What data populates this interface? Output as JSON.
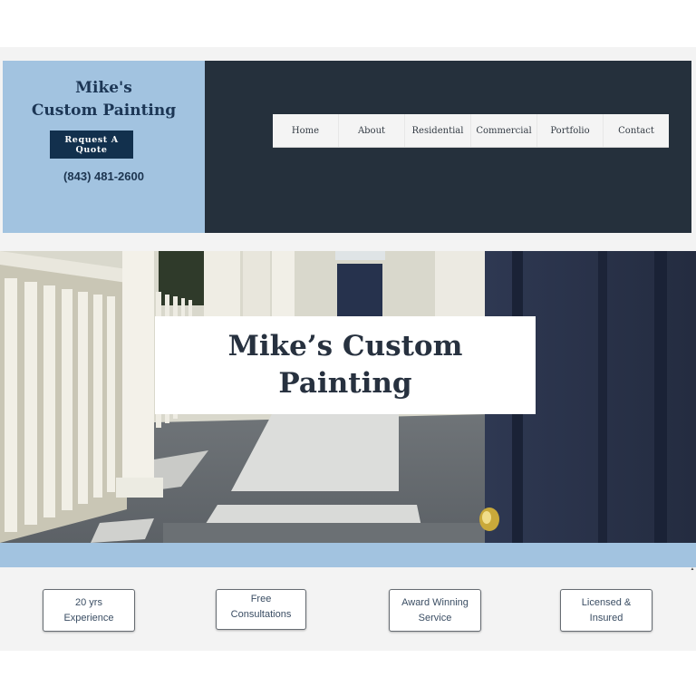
{
  "brand": {
    "title_line1": "Mike's",
    "title_line2": "Custom Painting",
    "cta_label": "Request A Quote",
    "phone": "(843) 481-2600"
  },
  "nav": {
    "items": [
      {
        "label": "Home"
      },
      {
        "label": "About"
      },
      {
        "label": "Residential"
      },
      {
        "label": "Commercial"
      },
      {
        "label": "Portfolio"
      },
      {
        "label": "Contact"
      }
    ]
  },
  "hero": {
    "title_line1": "Mike’s Custom",
    "title_line2": "Painting",
    "image_subject": "porch-with-white-railings-and-navy-door"
  },
  "features": [
    {
      "line1": "20 yrs",
      "line2": "Experience"
    },
    {
      "line1": "Free",
      "line2": "Consultations"
    },
    {
      "line1": "Award Winning",
      "line2": "Service"
    },
    {
      "line1": "Licensed &",
      "line2": "Insured"
    }
  ],
  "colors": {
    "light_blue": "#a2c3e0",
    "dark_navy": "#25303c",
    "button_navy": "#12304d",
    "heading_text": "#1c3655"
  }
}
